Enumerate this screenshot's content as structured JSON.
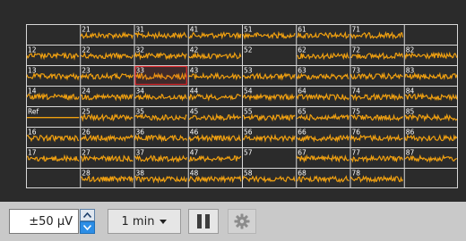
{
  "grid": {
    "rows": [
      [
        "",
        "21",
        "31",
        "41",
        "51",
        "61",
        "71",
        ""
      ],
      [
        "12",
        "22",
        "32",
        "42",
        "52",
        "62",
        "72",
        "82"
      ],
      [
        "13",
        "23",
        "33",
        "43",
        "53",
        "63",
        "73",
        "83"
      ],
      [
        "14",
        "24",
        "34",
        "44",
        "54",
        "64",
        "74",
        "84"
      ],
      [
        "Ref",
        "25",
        "35",
        "45",
        "55",
        "65",
        "75",
        "85"
      ],
      [
        "16",
        "26",
        "36",
        "46",
        "56",
        "66",
        "76",
        "86"
      ],
      [
        "17",
        "27",
        "37",
        "47",
        "57",
        "67",
        "77",
        "87"
      ],
      [
        "",
        "28",
        "38",
        "48",
        "58",
        "68",
        "78",
        ""
      ]
    ],
    "flat_channels": [
      "52",
      "57"
    ],
    "reference_channel": "Ref",
    "selected_channel": "33",
    "colors": {
      "trace": "#f0a010",
      "grid_line": "#d8d8d8",
      "label": "#ffffff",
      "selected": "#d9262b",
      "background": "#2b2b2b"
    }
  },
  "controls": {
    "scale_value": "±50 µV",
    "duration_value": "1 min",
    "spin_up_icon": "chevron-up-icon",
    "spin_down_icon": "chevron-down-icon",
    "duration_dropdown_icon": "caret-down-icon",
    "pause_icon": "pause-icon",
    "settings_icon": "gear-icon"
  }
}
